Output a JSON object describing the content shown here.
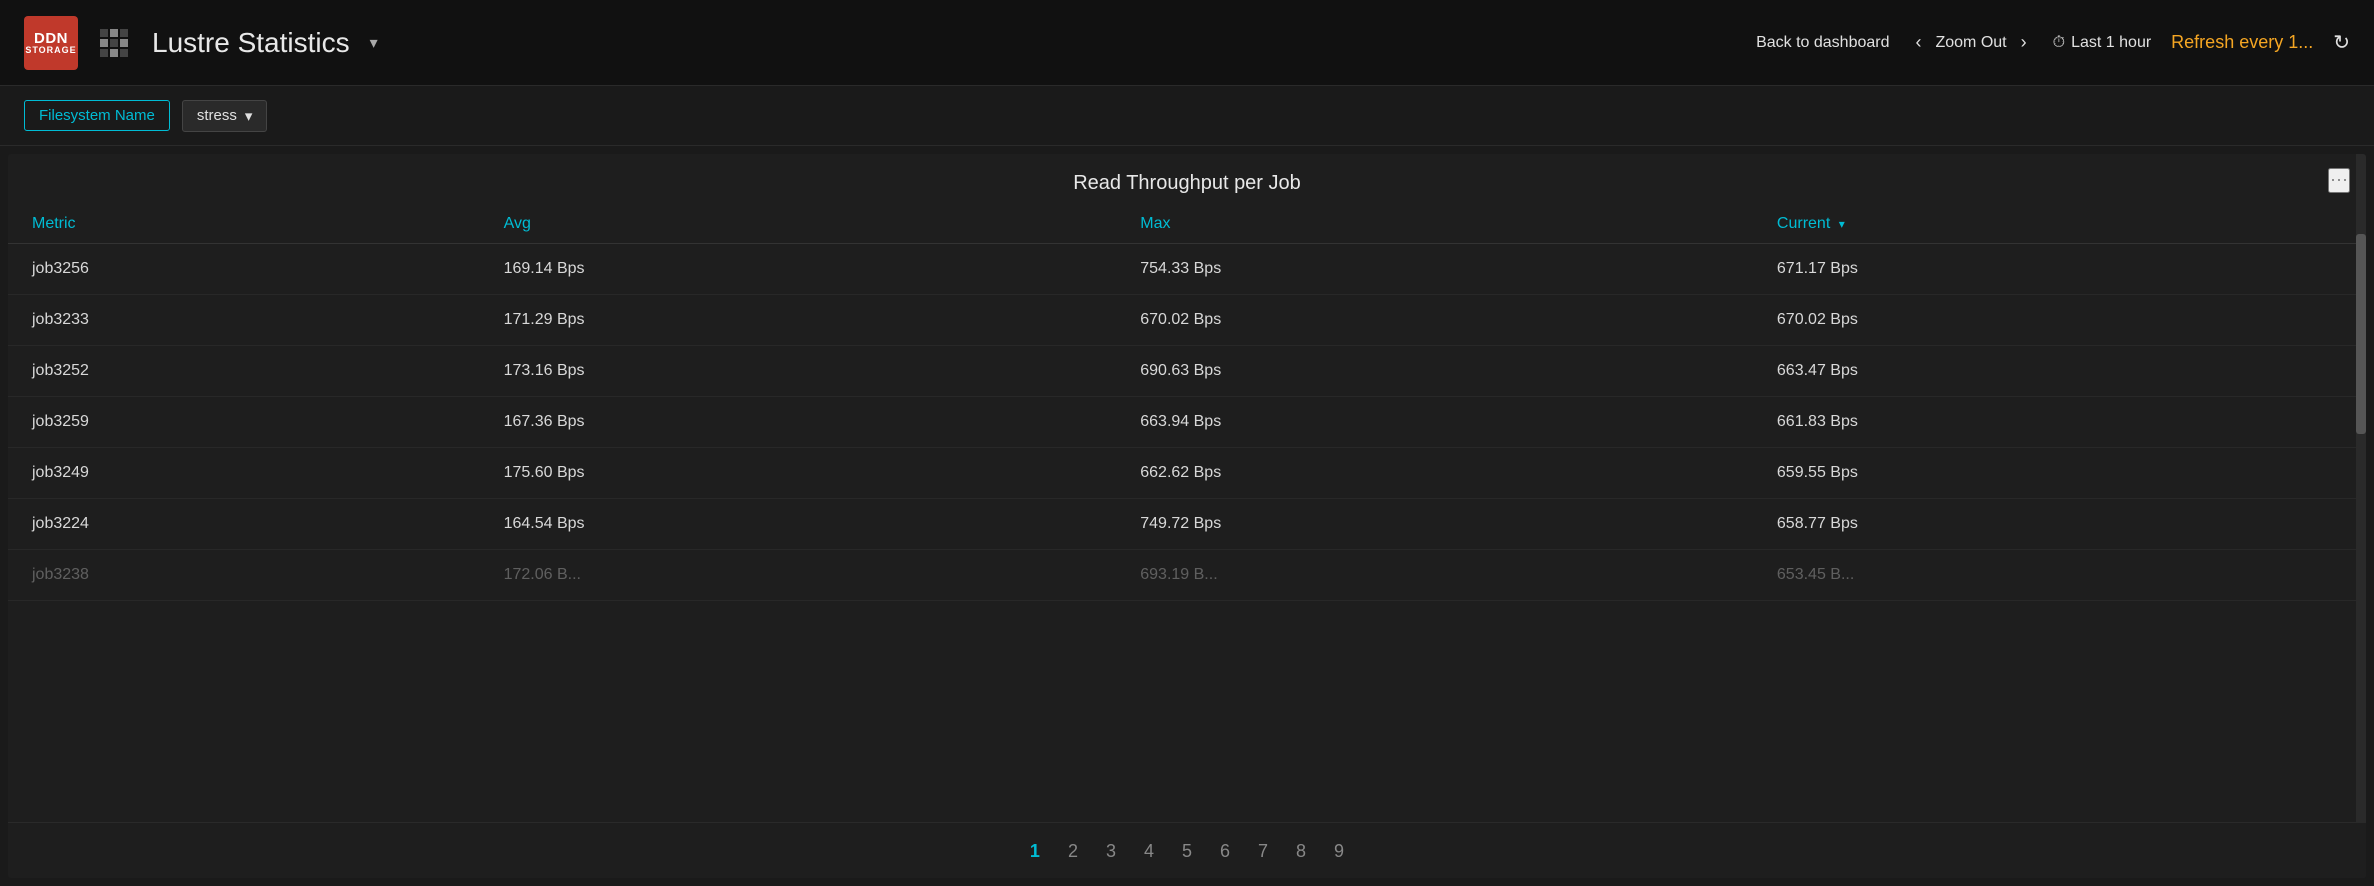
{
  "header": {
    "app_name": "Lustre Statistics",
    "back_label": "Back to dashboard",
    "zoom_label": "Zoom Out",
    "time_range_label": "Last 1 hour",
    "refresh_label": "Refresh every 1...",
    "ddn_label": "DDN",
    "storage_label": "STORAGE"
  },
  "filter_bar": {
    "filesystem_label": "Filesystem Name",
    "filesystem_value": "stress",
    "dropdown_arrow": "▾"
  },
  "table": {
    "title": "Read Throughput per Job",
    "columns": [
      {
        "key": "metric",
        "label": "Metric",
        "sortable": false
      },
      {
        "key": "avg",
        "label": "Avg",
        "sortable": false
      },
      {
        "key": "max",
        "label": "Max",
        "sortable": false
      },
      {
        "key": "current",
        "label": "Current",
        "sortable": true,
        "sort_arrow": "▾"
      }
    ],
    "rows": [
      {
        "metric": "job3256",
        "avg": "169.14 Bps",
        "max": "754.33 Bps",
        "current": "671.17 Bps"
      },
      {
        "metric": "job3233",
        "avg": "171.29 Bps",
        "max": "670.02 Bps",
        "current": "670.02 Bps"
      },
      {
        "metric": "job3252",
        "avg": "173.16 Bps",
        "max": "690.63 Bps",
        "current": "663.47 Bps"
      },
      {
        "metric": "job3259",
        "avg": "167.36 Bps",
        "max": "663.94 Bps",
        "current": "661.83 Bps"
      },
      {
        "metric": "job3249",
        "avg": "175.60 Bps",
        "max": "662.62 Bps",
        "current": "659.55 Bps"
      },
      {
        "metric": "job3224",
        "avg": "164.54 Bps",
        "max": "749.72 Bps",
        "current": "658.77 Bps"
      },
      {
        "metric": "job3238",
        "avg": "172.06 B...",
        "max": "693.19 B...",
        "current": "653.45 B..."
      }
    ]
  },
  "pagination": {
    "pages": [
      "1",
      "2",
      "3",
      "4",
      "5",
      "6",
      "7",
      "8",
      "9"
    ],
    "active_page": "1"
  },
  "colors": {
    "accent": "#00bcd4",
    "orange": "#f5a623",
    "bg_dark": "#111111",
    "bg_medium": "#1a1a1a",
    "bg_table": "#1e1e1e"
  }
}
